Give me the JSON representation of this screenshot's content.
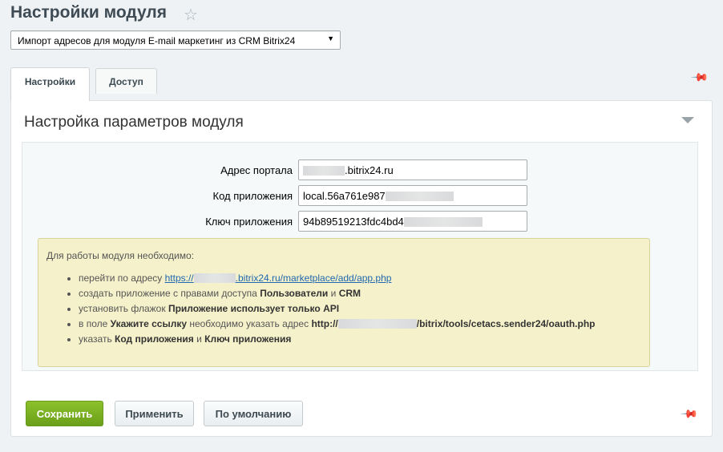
{
  "header": {
    "title": "Настройки модуля",
    "star_icon": "star-icon"
  },
  "module_select": {
    "selected": "Импорт адресов для модуля E-mail маркетинг из CRM Bitrix24"
  },
  "tabs": [
    {
      "label": "Настройки",
      "active": true
    },
    {
      "label": "Доступ",
      "active": false
    }
  ],
  "section": {
    "title": "Настройка параметров модуля"
  },
  "form": {
    "portal_label": "Адрес портала",
    "portal_value": ".bitrix24.ru",
    "app_code_label": "Код приложения",
    "app_code_value": "local.56a761e987",
    "app_key_label": "Ключ приложения",
    "app_key_value": "94b89519213fdc4bd4"
  },
  "notice": {
    "intro": "Для работы модуля необходимо:",
    "item1_prefix": "перейти по адресу ",
    "item1_link_prefix": "https://",
    "item1_link_suffix": ".bitrix24.ru/marketplace/add/app.php",
    "item2_prefix": "создать приложение с правами доступа ",
    "item2_b1": "Пользователи",
    "item2_mid": " и ",
    "item2_b2": "CRM",
    "item3_prefix": "установить флажок ",
    "item3_b": "Приложение использует только API",
    "item4_prefix": "в поле ",
    "item4_b1": "Укажите ссылку",
    "item4_mid": " необходимо указать адрес ",
    "item4_b2_prefix": "http://",
    "item4_b2_suffix": "/bitrix/tools/cetacs.sender24/oauth.php",
    "item5_prefix": "указать ",
    "item5_b1": "Код приложения",
    "item5_mid": " и ",
    "item5_b2": "Ключ приложения"
  },
  "buttons": {
    "save": "Сохранить",
    "apply": "Применить",
    "default": "По умолчанию"
  },
  "colors": {
    "save_button": "#7ab024",
    "notice_bg": "#f5f1ca",
    "link": "#2067b0"
  }
}
